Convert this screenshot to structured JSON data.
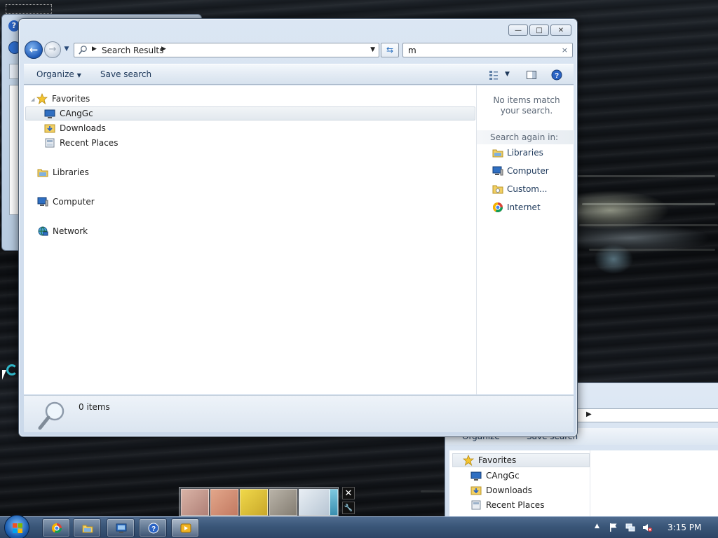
{
  "window": {
    "title_buttons": {
      "minimize": "—",
      "maximize": "□",
      "close": "✕"
    }
  },
  "navbar": {
    "back": "←",
    "forward": "→",
    "breadcrumb": "Search Results",
    "search_value": "m",
    "search_clear": "×"
  },
  "command_bar": {
    "organize_label": "Organize",
    "save_search_label": "Save search"
  },
  "nav_pane": {
    "favorites": "Favorites",
    "favorite_items": [
      "CAngGc",
      "Downloads",
      "Recent Places"
    ],
    "libraries": "Libraries",
    "computer": "Computer",
    "network": "Network"
  },
  "details_pane": {
    "no_match": "No items match your search.",
    "search_again_header": "Search again in:",
    "search_again_items": [
      "Libraries",
      "Computer",
      "Custom...",
      "Internet"
    ]
  },
  "status_bar": {
    "count": "0 items"
  },
  "background_window": {
    "organize_label": "Organize",
    "save_search_label": "Save search",
    "favorites": "Favorites",
    "favorite_items": [
      "CAngGc",
      "Downloads",
      "Recent Places"
    ]
  },
  "taskbar": {
    "clock": "3:15 PM",
    "apps": [
      "chrome-icon",
      "explorer-icon",
      "remote-desktop-icon",
      "help-icon",
      "media-player-icon"
    ]
  },
  "thumbnail_flyout": {
    "close": "✕",
    "tools": "🔧"
  },
  "colors": {
    "accent": "#2a63c4",
    "link_text": "#1e395b",
    "taskbar": "#3a5678"
  }
}
